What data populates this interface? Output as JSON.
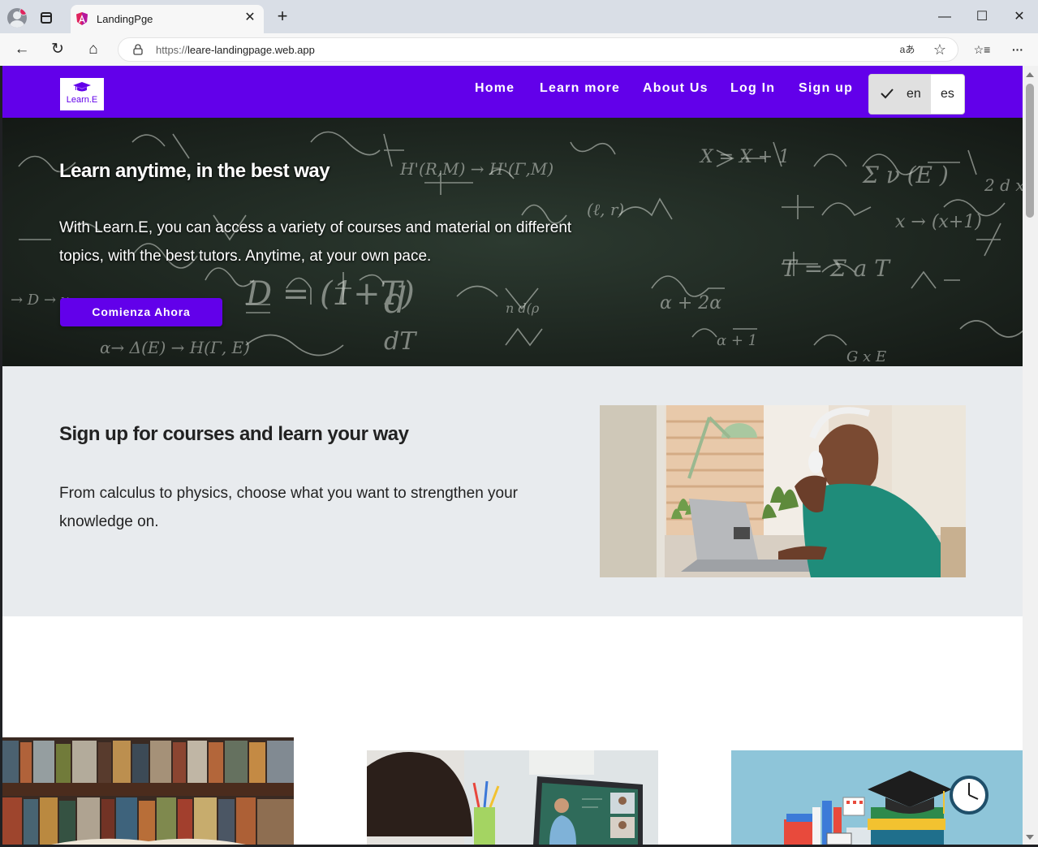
{
  "browser": {
    "tab_title": "LandingPge",
    "url_prefix": "https://",
    "url_host": "leare-landingpage.web.app",
    "tab_close": "✕",
    "new_tab": "+",
    "minimize": "—",
    "maximize": "☐",
    "close": "✕",
    "back": "←",
    "reload": "↻",
    "home": "⌂",
    "read_aloud": "aあ",
    "favorite": "☆",
    "favorites": "☆≡",
    "more": "···"
  },
  "navbar": {
    "logo_text": "Learn.E",
    "links": [
      "Home",
      "Learn more",
      "About Us",
      "Log In",
      "Sign up"
    ],
    "lang_selected": "en",
    "lang_other": "es"
  },
  "hero": {
    "title": "Learn anytime, in the best way",
    "text": "With Learn.E, you can access a variety of courses and material on different topics, with the best tutors. Anytime, at your own pace.",
    "cta": "Comienza Ahora"
  },
  "section2": {
    "title": "Sign up for courses and learn your way",
    "text": "From calculus to physics, choose what you want to strengthen your knowledge on."
  },
  "colors": {
    "brand": "#6200ea",
    "section_bg": "#e8ebee"
  }
}
